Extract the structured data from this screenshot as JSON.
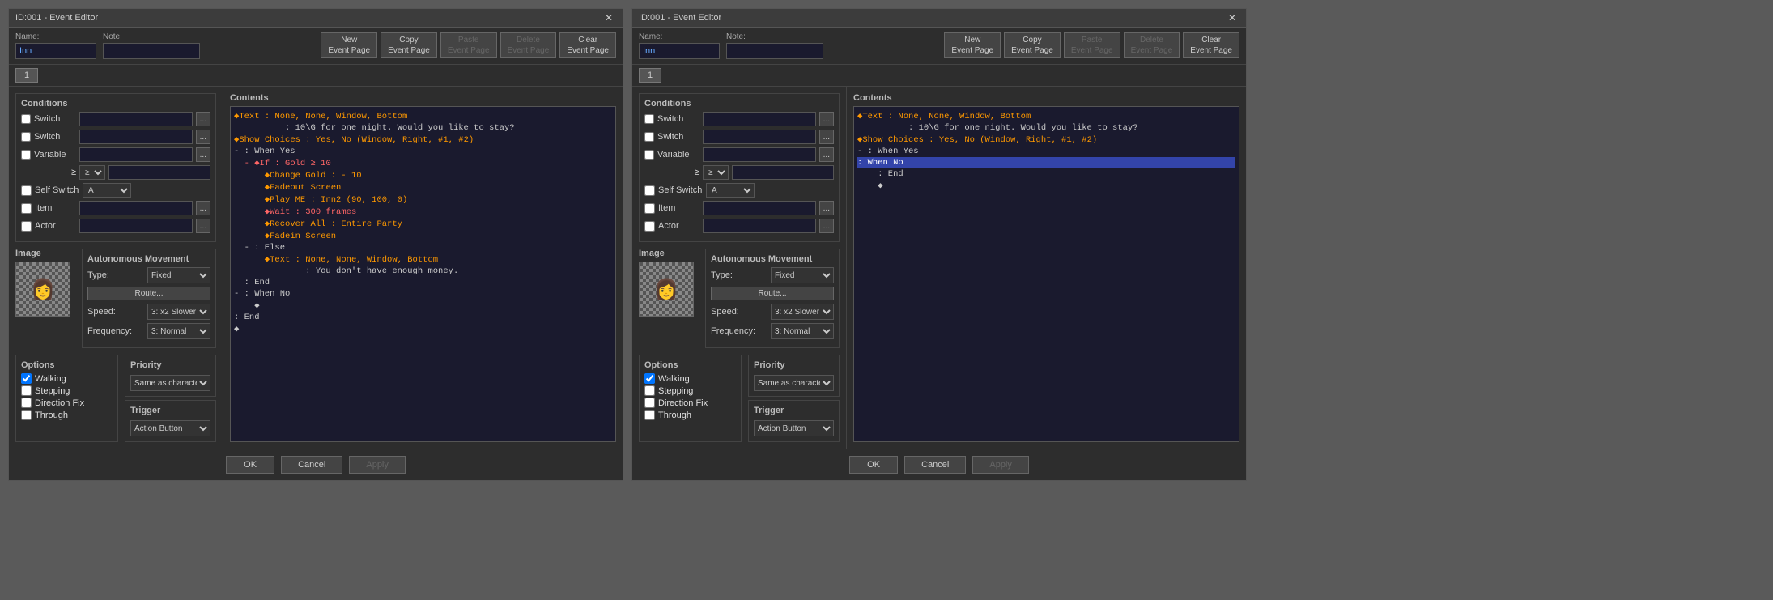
{
  "window1": {
    "title": "ID:001 - Event Editor",
    "name_label": "Name:",
    "note_label": "Note:",
    "name_value": "Inn",
    "note_value": "",
    "buttons": {
      "new": "New\nEvent Page",
      "copy": "Copy\nEvent Page",
      "paste": "Paste\nEvent Page",
      "delete": "Delete\nEvent Page",
      "clear": "Clear\nEvent Page"
    },
    "page_tab": "1",
    "conditions": {
      "title": "Conditions",
      "switch1_label": "Switch",
      "switch2_label": "Switch",
      "variable_label": "Variable",
      "self_switch_label": "Self Switch",
      "item_label": "Item",
      "actor_label": "Actor"
    },
    "image": {
      "title": "Image"
    },
    "movement": {
      "title": "Autonomous Movement",
      "type_label": "Type:",
      "type_value": "Fixed",
      "route_btn": "Route...",
      "speed_label": "Speed:",
      "speed_value": "3: x2 Slower",
      "frequency_label": "Frequency:",
      "frequency_value": "3: Normal"
    },
    "options": {
      "title": "Options",
      "walking": "Walking",
      "stepping": "Stepping",
      "direction_fix": "Direction Fix",
      "through": "Through",
      "walking_checked": true
    },
    "priority": {
      "title": "Priority",
      "value": "Same as characters"
    },
    "trigger": {
      "title": "Trigger",
      "value": "Action Button"
    },
    "contents": {
      "title": "Contents",
      "lines": [
        {
          "text": "◆Text : None, None, Window, Bottom",
          "style": "orange"
        },
        {
          "text": "          : 10\\G for one night. Would you like to stay?",
          "style": "normal"
        },
        {
          "text": "◆Show Choices : Yes, No (Window, Right, #1, #2)",
          "style": "orange"
        },
        {
          "text": "- : When Yes",
          "style": "normal"
        },
        {
          "text": "  - ◆If : Gold ≥ 10",
          "style": "red"
        },
        {
          "text": "      ◆Change Gold : - 10",
          "style": "orange"
        },
        {
          "text": "      ◆Fadeout Screen",
          "style": "orange"
        },
        {
          "text": "      ◆Play ME : Inn2 (90, 100, 0)",
          "style": "orange"
        },
        {
          "text": "      ◆Wait : 300 frames",
          "style": "red"
        },
        {
          "text": "      ◆Recover All : Entire Party",
          "style": "orange"
        },
        {
          "text": "      ◆Fadein Screen",
          "style": "orange"
        },
        {
          "text": "  - : Else",
          "style": "normal"
        },
        {
          "text": "      ◆Text : None, None, Window, Bottom",
          "style": "orange"
        },
        {
          "text": "              : You don't have enough money.",
          "style": "normal"
        },
        {
          "text": "  : End",
          "style": "normal"
        },
        {
          "text": "- : When No",
          "style": "normal"
        },
        {
          "text": "    ◆",
          "style": "normal"
        },
        {
          "text": ": End",
          "style": "normal"
        },
        {
          "text": "◆",
          "style": "normal"
        }
      ]
    },
    "footer": {
      "ok": "OK",
      "cancel": "Cancel",
      "apply": "Apply"
    }
  },
  "window2": {
    "title": "ID:001 - Event Editor",
    "name_label": "Name:",
    "note_label": "Note:",
    "name_value": "Inn",
    "note_value": "",
    "buttons": {
      "new": "New\nEvent Page",
      "copy": "Copy\nEvent Page",
      "paste": "Paste\nEvent Page",
      "delete": "Delete\nEvent Page",
      "clear": "Clear\nEvent Page"
    },
    "page_tab": "1",
    "conditions": {
      "title": "Conditions",
      "switch1_label": "Switch",
      "switch2_label": "Switch",
      "variable_label": "Variable",
      "self_switch_label": "Self Switch",
      "item_label": "Item",
      "actor_label": "Actor"
    },
    "image": {
      "title": "Image"
    },
    "movement": {
      "title": "Autonomous Movement",
      "type_label": "Type:",
      "type_value": "Fixed",
      "route_btn": "Route...",
      "speed_label": "Speed:",
      "speed_value": "3: x2 Slower",
      "frequency_label": "Frequency:",
      "frequency_value": "3: Normal"
    },
    "options": {
      "title": "Options",
      "walking": "Walking",
      "stepping": "Stepping",
      "direction_fix": "Direction Fix",
      "through": "Through",
      "walking_checked": true
    },
    "priority": {
      "title": "Priority",
      "value": "Same as characters"
    },
    "trigger": {
      "title": "Trigger",
      "value": "Action Button"
    },
    "contents": {
      "title": "Contents",
      "lines": [
        {
          "text": "◆Text : None, None, Window, Bottom",
          "style": "orange"
        },
        {
          "text": "          : 10\\G for one night. Would you like to stay?",
          "style": "normal"
        },
        {
          "text": "◆Show Choices : Yes, No (Window, Right, #1, #2)",
          "style": "orange"
        },
        {
          "text": "- : When Yes",
          "style": "normal"
        },
        {
          "text": ": When No",
          "style": "selected"
        },
        {
          "text": "    : End",
          "style": "normal"
        },
        {
          "text": "    ◆",
          "style": "normal"
        }
      ]
    },
    "footer": {
      "ok": "OK",
      "cancel": "Cancel",
      "apply": "Apply"
    }
  }
}
